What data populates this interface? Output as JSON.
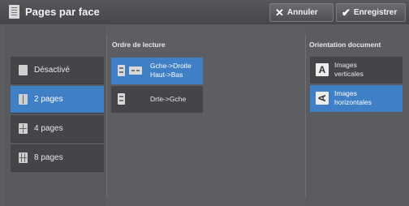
{
  "header": {
    "title": "Pages par face",
    "cancel_label": "Annuler",
    "cancel_icon": "✕",
    "save_label": "Enregistrer",
    "save_icon": "✔"
  },
  "pages_options": [
    {
      "label": "Désactivé",
      "icon": "single-page-icon",
      "selected": false
    },
    {
      "label": "2 pages",
      "icon": "two-pages-icon",
      "selected": true
    },
    {
      "label": "4 pages",
      "icon": "four-pages-icon",
      "selected": false
    },
    {
      "label": "8 pages",
      "icon": "eight-pages-icon",
      "selected": false
    }
  ],
  "reading_order": {
    "label": "Ordre de lecture",
    "options": [
      {
        "line1": "Gche->Droite",
        "line2": "Haut->Bas",
        "selected": true
      },
      {
        "line1": "Drte->Gche",
        "selected": false
      }
    ]
  },
  "orientation": {
    "label": "Orientation document",
    "options": [
      {
        "icon_letter": "A",
        "line1": "Images",
        "line2": "verticales",
        "selected": false
      },
      {
        "icon_letter": "A",
        "line1": "Images",
        "line2": "horizontales",
        "selected": true
      }
    ]
  },
  "colors": {
    "accent": "#3f7fc6",
    "panel": "#5d5e61",
    "button": "#444549"
  }
}
